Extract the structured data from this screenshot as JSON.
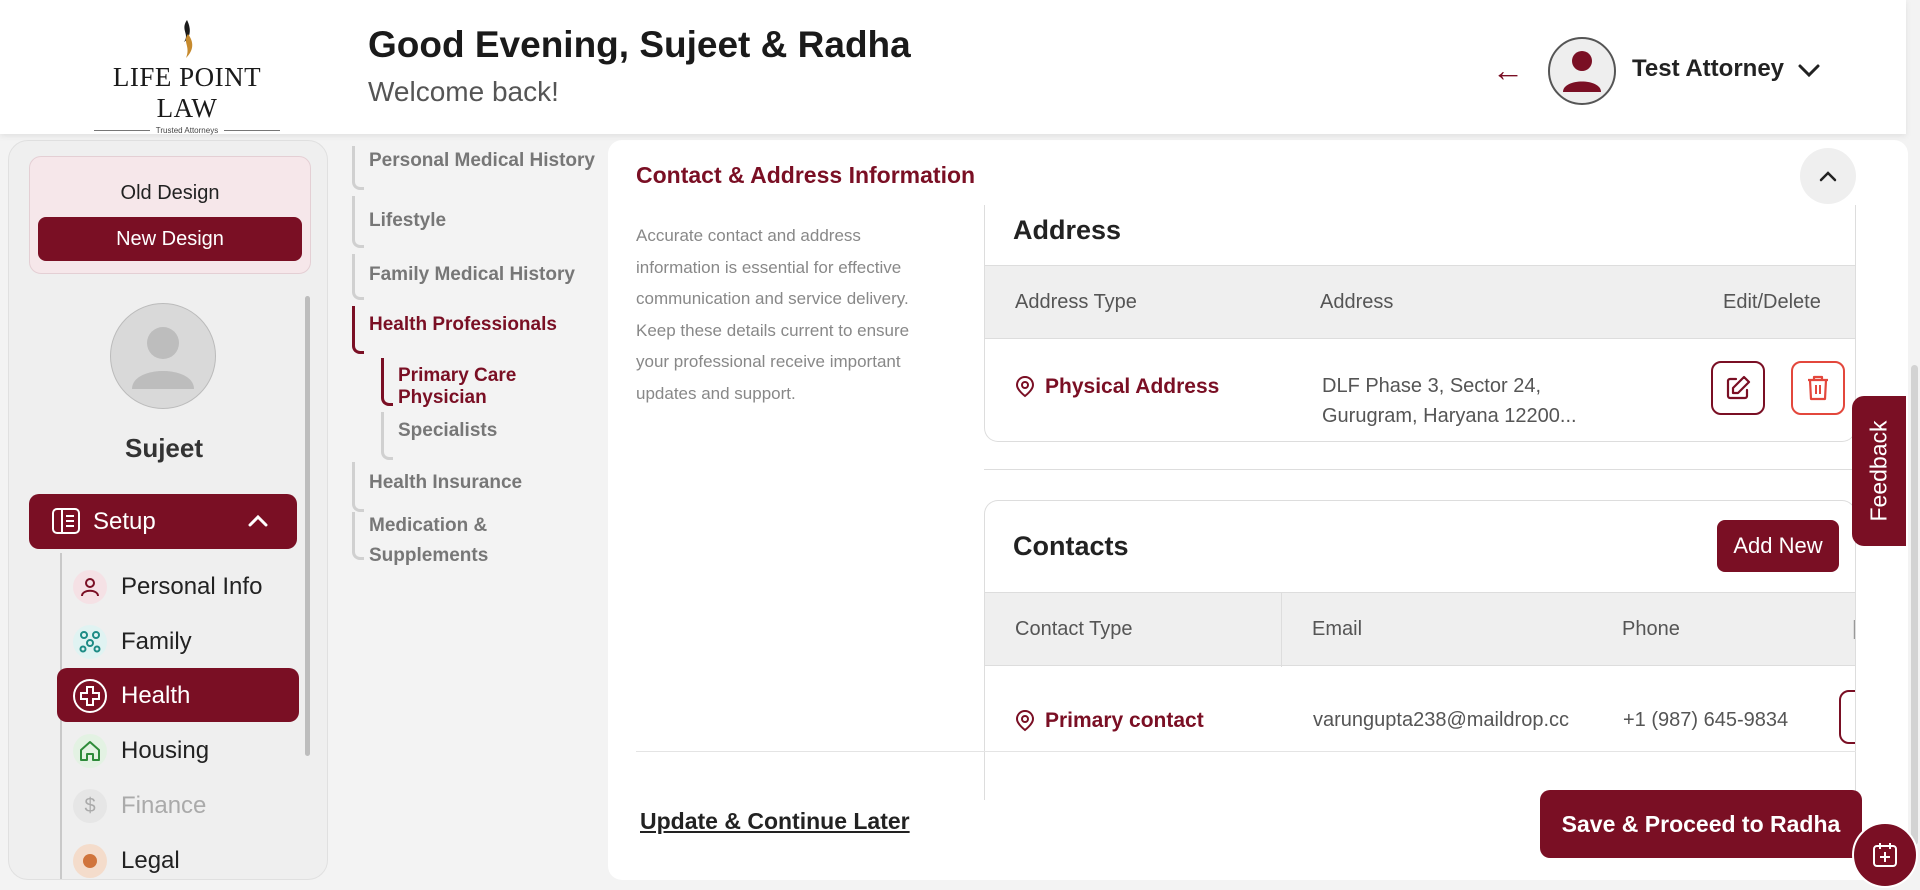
{
  "header": {
    "logo_text": "LIFE POINT LAW",
    "logo_tagline": "Trusted Attorneys",
    "greeting": "Good Evening, Sujeet & Radha",
    "welcome": "Welcome back!",
    "user_name": "Test Attorney",
    "back_arrow": "←"
  },
  "sidebar": {
    "old_design": "Old Design",
    "new_design": "New Design",
    "profile_name": "Sujeet",
    "setup_label": "Setup",
    "items": [
      {
        "label": "Personal Info",
        "icon": "person-icon"
      },
      {
        "label": "Family",
        "icon": "family-icon"
      },
      {
        "label": "Health",
        "icon": "health-cross-icon",
        "active": true
      },
      {
        "label": "Housing",
        "icon": "house-icon"
      },
      {
        "label": "Finance",
        "icon": "dollar-icon",
        "disabled": true
      },
      {
        "label": "Legal",
        "icon": "legal-icon"
      }
    ]
  },
  "subnav": {
    "items": [
      "Personal Medical History",
      "Lifestyle",
      "Family Medical History",
      "Health Professionals",
      "Primary Care Physician",
      "Specialists",
      "Health Insurance",
      "Medication &",
      "Supplements"
    ]
  },
  "main": {
    "section_title": "Contact & Address Information",
    "description": "Accurate contact and address information is essential for effective communication and service delivery. Keep these details current to ensure your professional receive important updates and support.",
    "address": {
      "title": "Address",
      "columns": [
        "Address Type",
        "Address",
        "Edit/Delete"
      ],
      "rows": [
        {
          "type": "Physical Address",
          "address_line1": "DLF Phase 3, Sector 24,",
          "address_line2": "Gurugram, Haryana 12200..."
        }
      ]
    },
    "contacts": {
      "title": "Contacts",
      "add_new": "Add New",
      "columns": [
        "Contact Type",
        "Email",
        "Phone"
      ],
      "rows": [
        {
          "type": "Primary contact",
          "email": "varungupta238@maildrop.cc",
          "phone": "+1 (987) 645-9834"
        }
      ]
    },
    "update_later": "Update & Continue Later",
    "save_proceed": "Save & Proceed to Radha"
  },
  "feedback": "Feedback",
  "colors": {
    "brand": "#7a0f24",
    "background": "#f3f3f3"
  }
}
